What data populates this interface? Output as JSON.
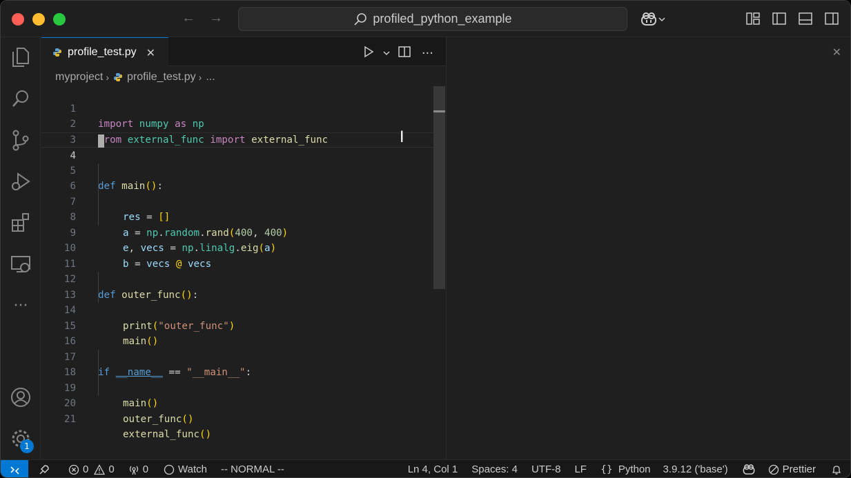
{
  "window": {
    "command_center_text": "profiled_python_example"
  },
  "tab": {
    "label": "profile_test.py",
    "close": "✕"
  },
  "breadcrumb": {
    "folder": "myproject",
    "file": "profile_test.py",
    "more": "..."
  },
  "editor": {
    "current_line": 4,
    "lines": [
      {
        "n": "1"
      },
      {
        "n": "2"
      },
      {
        "n": "3"
      },
      {
        "n": "4"
      },
      {
        "n": "5"
      },
      {
        "n": "6"
      },
      {
        "n": "7"
      },
      {
        "n": "8"
      },
      {
        "n": "9"
      },
      {
        "n": "10"
      },
      {
        "n": "11"
      },
      {
        "n": "12"
      },
      {
        "n": "13"
      },
      {
        "n": "14"
      },
      {
        "n": "15"
      },
      {
        "n": "16"
      },
      {
        "n": "17"
      },
      {
        "n": "18"
      },
      {
        "n": "19"
      },
      {
        "n": "20"
      },
      {
        "n": "21"
      }
    ],
    "code": {
      "l1": {
        "kw": "import",
        "mod": "numpy",
        "as": "as",
        "alias": "np"
      },
      "l2": {
        "kw": "from",
        "mod": "external_func",
        "imp": "import",
        "name": "external_func"
      },
      "l5": {
        "kw": "def",
        "fn": "main",
        "paren": "()",
        "colon": ":"
      },
      "l6": {
        "var": "res",
        "eq": " = ",
        "list": "[]"
      },
      "l7": {
        "var": "a",
        "eq": " = ",
        "np": "np",
        "dot1": ".",
        "random": "random",
        "dot2": ".",
        "rand": "rand",
        "open": "(",
        "a1": "400",
        "comma": ", ",
        "a2": "400",
        "close": ")"
      },
      "l8": {
        "e": "e",
        "comma": ", ",
        "vecs": "vecs",
        "eq": " = ",
        "np": "np",
        "dot1": ".",
        "linalg": "linalg",
        "dot2": ".",
        "eig": "eig",
        "open": "(",
        "arg": "a",
        "close": ")"
      },
      "l9": {
        "b": "b",
        "eq": " = ",
        "v1": "vecs",
        "at": " @ ",
        "v2": "vecs"
      },
      "l12": {
        "kw": "def",
        "fn": "outer_func",
        "paren": "()",
        "colon": ":"
      },
      "l13": {
        "fn": "print",
        "open": "(",
        "str": "\"outer_func\"",
        "close": ")"
      },
      "l14": {
        "fn": "main",
        "paren": "()"
      },
      "l17": {
        "kw": "if",
        "dunder": "__name__",
        "eq": " == ",
        "str": "\"__main__\"",
        "colon": ":"
      },
      "l18": {
        "fn": "main",
        "paren": "()"
      },
      "l19": {
        "fn": "outer_func",
        "paren": "()"
      },
      "l20": {
        "fn": "external_func",
        "paren": "()"
      }
    }
  },
  "statusbar": {
    "errors": "0",
    "warnings": "0",
    "ports": "0",
    "watch": "Watch",
    "vim_mode": "-- NORMAL --",
    "position": "Ln 4, Col 1",
    "spaces": "Spaces: 4",
    "encoding": "UTF-8",
    "eol": "LF",
    "language": "Python",
    "interpreter": "3.9.12 ('base')",
    "formatter": "Prettier"
  },
  "activity": {
    "settings_badge": "1"
  },
  "icons": [
    "explorer-icon",
    "search-icon",
    "source-control-icon",
    "run-debug-icon",
    "extensions-icon",
    "remote-explorer-icon",
    "more-icon",
    "account-icon",
    "manage-gear-icon",
    "copilot-icon",
    "python-file-icon",
    "run-icon",
    "split-editor-icon",
    "bell-icon"
  ],
  "colors": {
    "accent": "#0078d4",
    "background": "#1f1f1f",
    "keyword": "#c586c0",
    "module": "#4ec9b0",
    "function": "#dcdcaa",
    "variable": "#9cdcfe",
    "number": "#b5cea8",
    "string": "#ce9178"
  }
}
